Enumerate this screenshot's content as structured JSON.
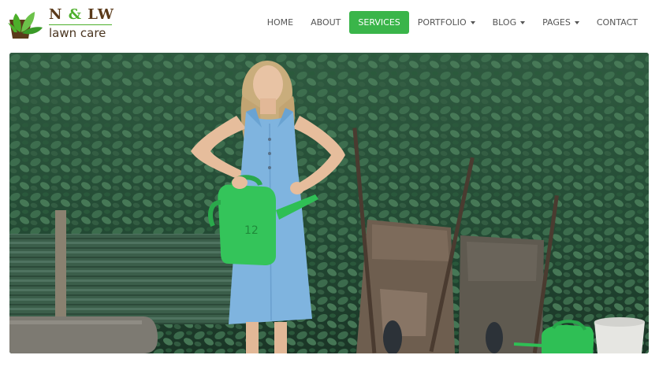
{
  "brand": {
    "name_left": "N",
    "name_amp": "&",
    "name_right": "LW",
    "tagline": "lawn care",
    "leaf_color": "#4caf2a",
    "pot_color": "#5a3a1a"
  },
  "nav": {
    "items": [
      {
        "label": "HOME",
        "has_dropdown": false,
        "active": false
      },
      {
        "label": "ABOUT",
        "has_dropdown": false,
        "active": false
      },
      {
        "label": "SERVICES",
        "has_dropdown": false,
        "active": true
      },
      {
        "label": "PORTFOLIO",
        "has_dropdown": true,
        "active": false
      },
      {
        "label": "BLOG",
        "has_dropdown": true,
        "active": false
      },
      {
        "label": "PAGES",
        "has_dropdown": true,
        "active": false
      },
      {
        "label": "CONTACT",
        "has_dropdown": false,
        "active": false
      }
    ],
    "active_color": "#3ab54a"
  },
  "hero": {
    "watering_can_number": "12"
  }
}
